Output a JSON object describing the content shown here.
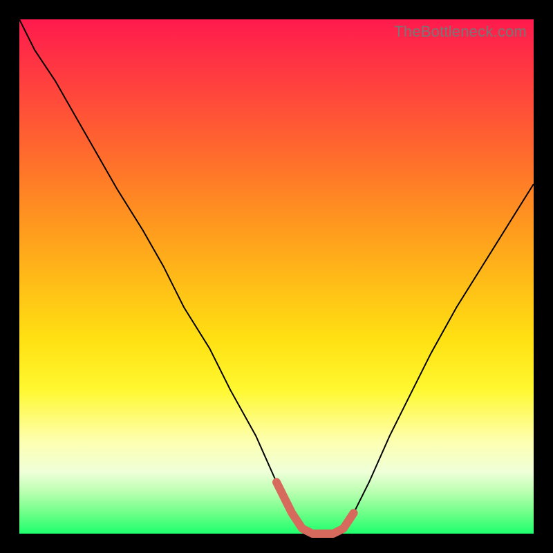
{
  "watermark": "TheBottleneck.com",
  "colors": {
    "gradient_top": "#ff1a4d",
    "gradient_bottom": "#1eff6e",
    "curve": "#000000",
    "highlight": "#d66a5c",
    "frame": "#000000"
  },
  "chart_data": {
    "type": "line",
    "title": "",
    "xlabel": "",
    "ylabel": "",
    "xlim": [
      0,
      100
    ],
    "ylim": [
      0,
      100
    ],
    "grid": false,
    "legend": false,
    "series": [
      {
        "name": "bottleneck-curve",
        "x": [
          0,
          3,
          7,
          11,
          15,
          19,
          24,
          28,
          32,
          37,
          41,
          46,
          50,
          53,
          55,
          57,
          59,
          61,
          63,
          65,
          68,
          72,
          76,
          80,
          85,
          90,
          95,
          100
        ],
        "y": [
          100,
          94,
          88,
          81,
          74,
          67,
          59,
          52,
          44,
          36,
          28,
          19,
          10,
          4,
          1,
          0,
          0,
          0,
          1,
          4,
          10,
          19,
          27,
          35,
          44,
          52,
          60,
          68
        ]
      }
    ],
    "highlight_region": {
      "x": [
        50,
        53,
        55,
        57,
        59,
        61,
        63,
        65
      ],
      "y": [
        10,
        4,
        1,
        0,
        0,
        0,
        1,
        4
      ]
    }
  }
}
